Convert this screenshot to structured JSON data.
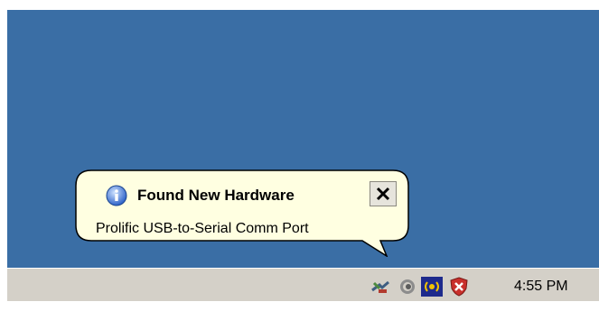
{
  "desktop": {
    "background_color": "#3A6EA5"
  },
  "balloon": {
    "icon": "info-icon",
    "title": "Found New Hardware",
    "message": "Prolific USB-to-Serial Comm Port",
    "close_icon": "close-icon",
    "background_color": "#FFFFE1"
  },
  "taskbar": {
    "background_color": "#D4D0C8",
    "tray": {
      "icons": [
        "safely-remove-hardware-icon",
        "volume-icon",
        "wireless-network-icon",
        "security-alert-shield-icon"
      ],
      "clock": "4:55 PM"
    }
  }
}
